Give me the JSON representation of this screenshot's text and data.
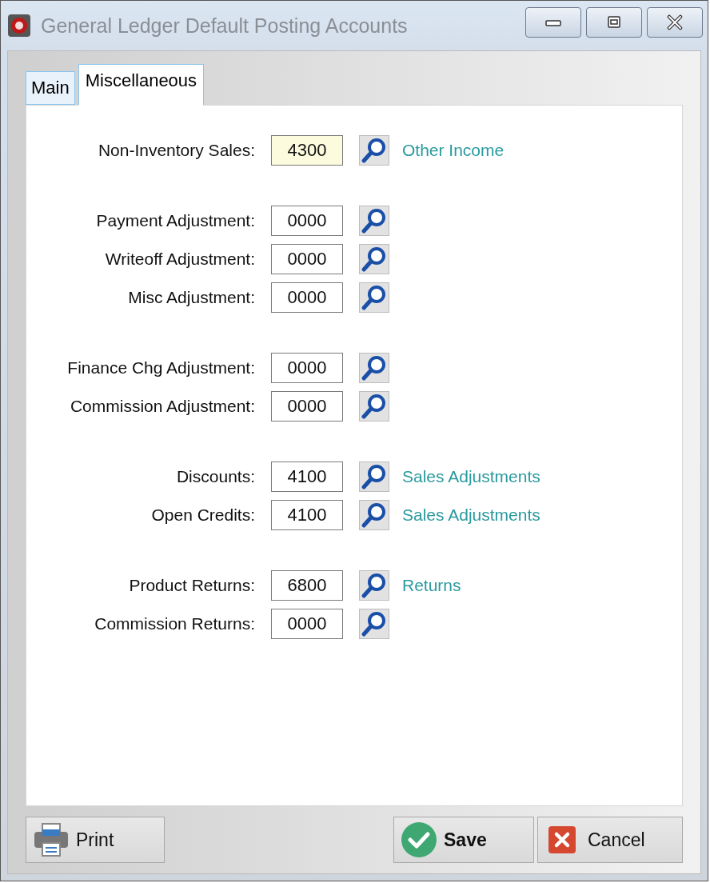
{
  "window": {
    "title": "General Ledger Default Posting Accounts"
  },
  "tabs": [
    {
      "label": "Main",
      "selected": false
    },
    {
      "label": "Miscellaneous",
      "selected": true
    }
  ],
  "groups": [
    {
      "rows": [
        {
          "label": "Non-Inventory Sales:",
          "value": "4300",
          "focused": true,
          "description": "Other Income"
        }
      ]
    },
    {
      "rows": [
        {
          "label": "Payment Adjustment:",
          "value": "0000",
          "focused": false
        },
        {
          "label": "Writeoff Adjustment:",
          "value": "0000",
          "focused": false
        },
        {
          "label": "Misc Adjustment:",
          "value": "0000",
          "focused": false
        }
      ]
    },
    {
      "rows": [
        {
          "label": "Finance Chg Adjustment:",
          "value": "0000",
          "focused": false
        },
        {
          "label": "Commission Adjustment:",
          "value": "0000",
          "focused": false
        }
      ]
    },
    {
      "rows": [
        {
          "label": "Discounts:",
          "value": "4100",
          "focused": false,
          "description": "Sales Adjustments"
        },
        {
          "label": "Open Credits:",
          "value": "4100",
          "focused": false,
          "description": "Sales Adjustments"
        }
      ]
    },
    {
      "rows": [
        {
          "label": "Product Returns:",
          "value": "6800",
          "focused": false,
          "description": "Returns"
        },
        {
          "label": "Commission Returns:",
          "value": "0000",
          "focused": false
        }
      ]
    }
  ],
  "buttons": [
    {
      "label": "Print",
      "kind": "print"
    },
    {
      "label": "Save",
      "kind": "save"
    },
    {
      "label": "Cancel",
      "kind": "cancel"
    }
  ]
}
